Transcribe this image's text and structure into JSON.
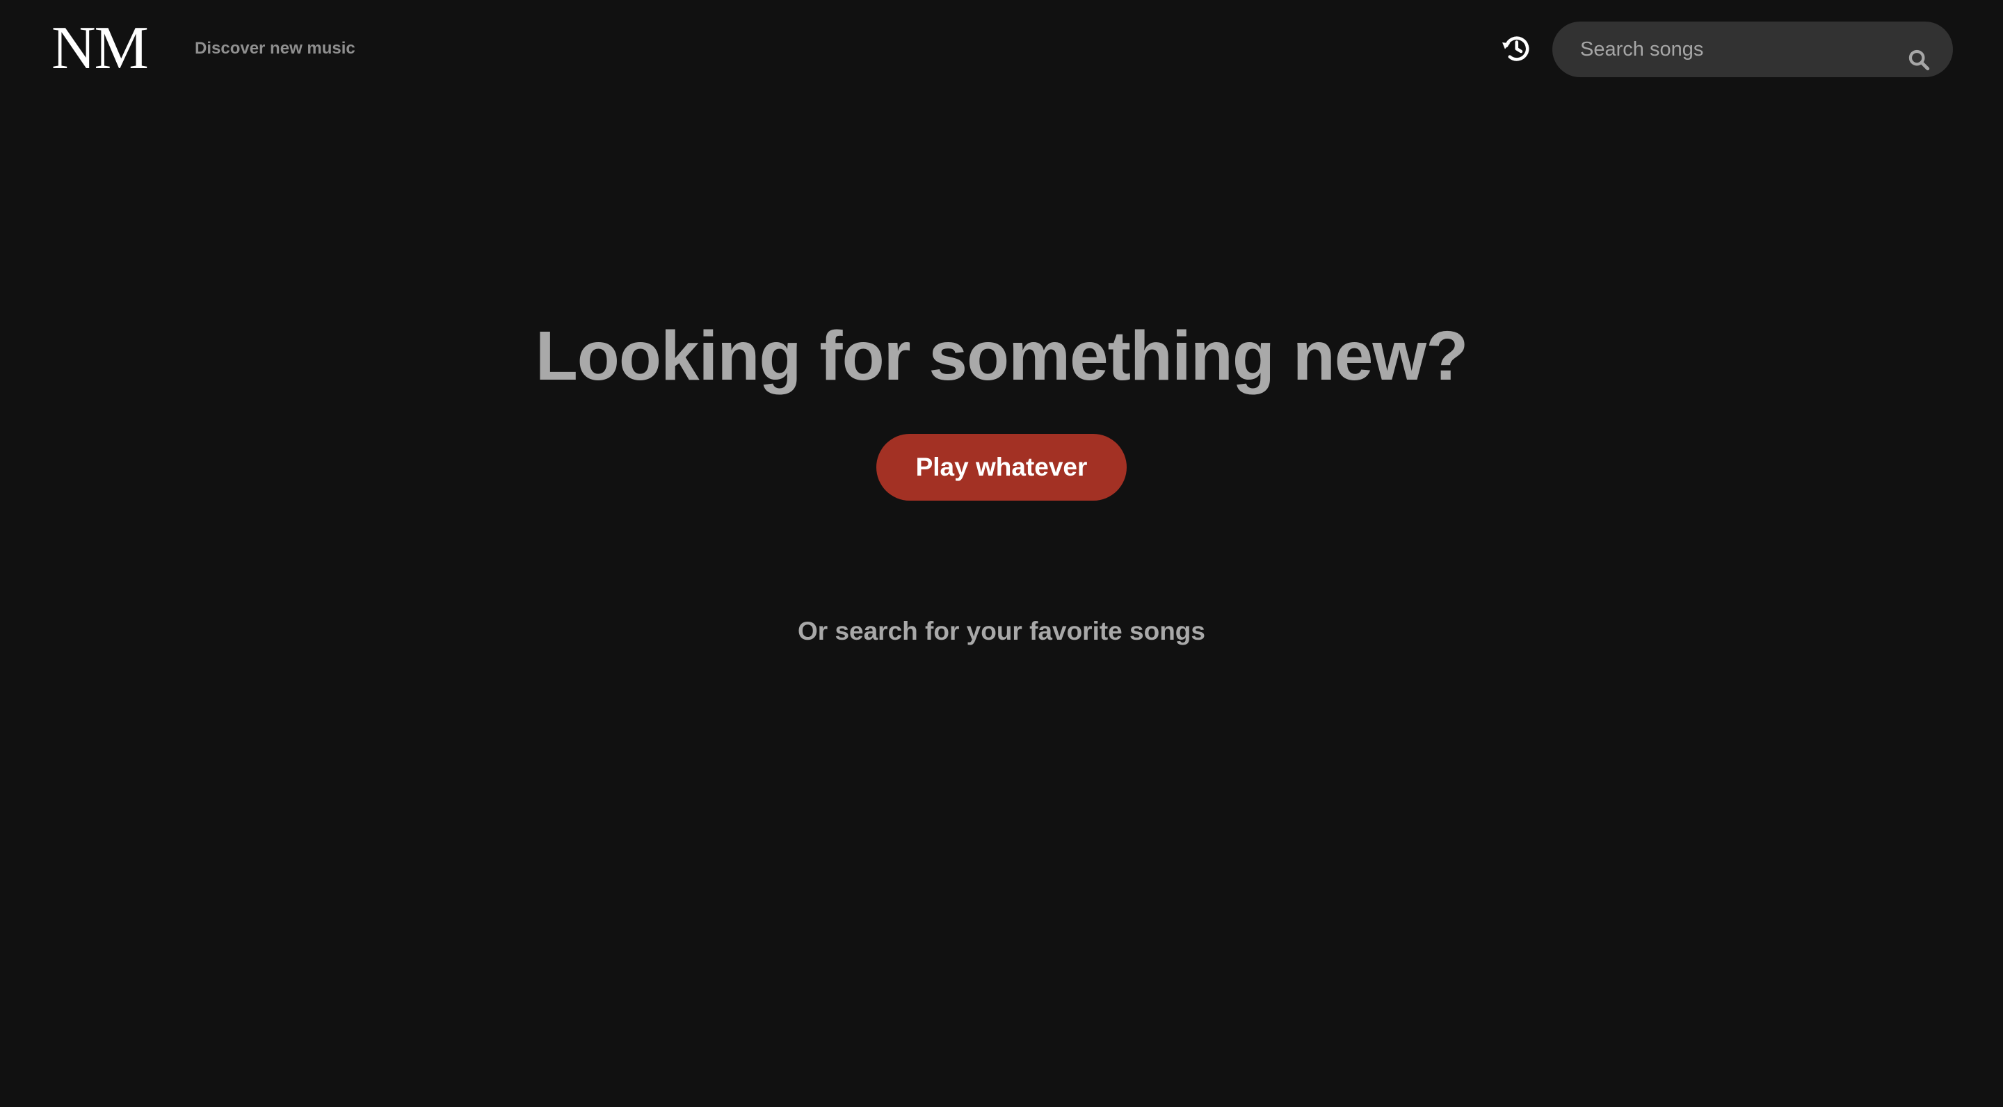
{
  "header": {
    "logo_text": "NM",
    "tagline": "Discover new music",
    "history_icon": "history-icon",
    "search": {
      "placeholder": "Search songs",
      "value": "",
      "icon": "search-icon"
    }
  },
  "hero": {
    "title": "Looking for something new?",
    "play_button_label": "Play whatever",
    "subtext": "Or search for your favorite songs"
  },
  "colors": {
    "background": "#111111",
    "accent": "#a33124",
    "muted_text": "#a9a9a9",
    "search_bg": "#323232"
  }
}
